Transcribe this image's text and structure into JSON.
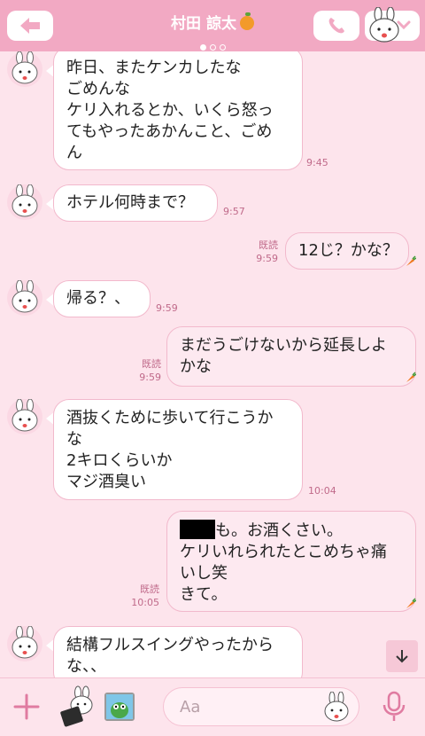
{
  "header": {
    "title": "村田 諒太",
    "page_indicator": {
      "count": 3,
      "active": 1
    }
  },
  "colors": {
    "header": "#f2a9c3",
    "background": "#fde4ec",
    "bubble_incoming": "#ffffff",
    "bubble_outgoing": "#fde9f0",
    "bubble_border": "#f2b9cc",
    "timestamp": "#c06a8a",
    "mic": "#e07ba1"
  },
  "messages": [
    {
      "from": "them",
      "lines": [
        "昨日、またケンカしたな",
        "ごめんな",
        "ケリ入れるとか、いくら怒っ",
        "てもやったあかんこと、ごめ",
        "ん"
      ],
      "time": "9:45"
    },
    {
      "from": "them",
      "lines": [
        "ホテル何時まで？"
      ],
      "time": "9:57"
    },
    {
      "from": "me",
      "lines": [
        "12じ？かな？"
      ],
      "read": "既読",
      "time": "9:59"
    },
    {
      "from": "them",
      "lines": [
        "帰る？、"
      ],
      "time": "9:59"
    },
    {
      "from": "me",
      "lines": [
        "まだうごけないから延長しよ",
        "かな"
      ],
      "read": "既読",
      "time": "9:59"
    },
    {
      "from": "them",
      "lines": [
        "酒抜くために歩いて行こうか",
        "な",
        "2キロくらいか",
        "マジ酒臭い"
      ],
      "time": "10:04"
    },
    {
      "from": "me",
      "lines": [
        "も。お酒くさい。",
        "ケリいれられたとこめちゃ痛",
        "いし笑",
        "きて。"
      ],
      "read": "既読",
      "time": "10:05",
      "redacted_prefix": true
    },
    {
      "from": "them",
      "lines": [
        "結構フルスイングやったから",
        "な、、"
      ],
      "time": ""
    }
  ],
  "footer": {
    "input_placeholder": "Aa"
  },
  "icons": {
    "back": "back-arrow-icon",
    "call": "phone-icon",
    "menu": "chevron-down-icon",
    "scroll": "arrow-down-icon",
    "plus": "plus-icon",
    "sticker": "sticker-icon",
    "photo": "photo-icon",
    "emoji": "emoji-icon",
    "mic": "mic-icon"
  }
}
